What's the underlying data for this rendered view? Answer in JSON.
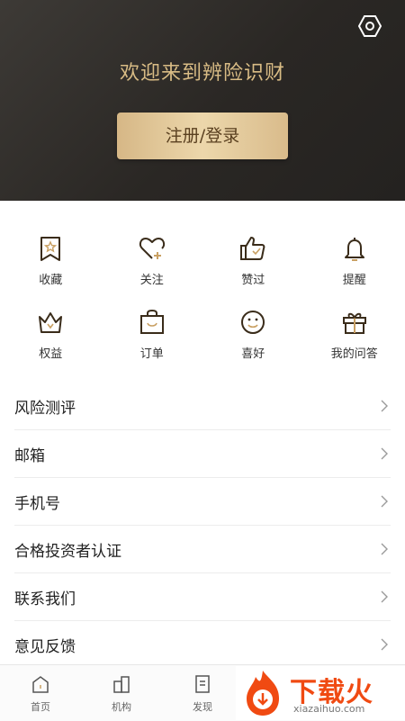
{
  "header": {
    "welcome": "欢迎来到辨险识财",
    "login_label": "注册/登录"
  },
  "quick_grid": [
    {
      "label": "收藏",
      "icon": "bookmark-icon"
    },
    {
      "label": "关注",
      "icon": "heart-plus-icon"
    },
    {
      "label": "赞过",
      "icon": "thumbs-up-icon"
    },
    {
      "label": "提醒",
      "icon": "bell-icon"
    },
    {
      "label": "权益",
      "icon": "crown-icon"
    },
    {
      "label": "订单",
      "icon": "bag-icon"
    },
    {
      "label": "喜好",
      "icon": "smile-icon"
    },
    {
      "label": "我的问答",
      "icon": "gift-icon"
    }
  ],
  "menu": [
    {
      "label": "风险测评"
    },
    {
      "label": "邮箱"
    },
    {
      "label": "手机号"
    },
    {
      "label": "合格投资者认证"
    },
    {
      "label": "联系我们"
    },
    {
      "label": "意见反馈"
    }
  ],
  "tabbar": [
    {
      "label": "首页",
      "icon": "home-icon"
    },
    {
      "label": "机构",
      "icon": "building-icon"
    },
    {
      "label": "发现",
      "icon": "discover-icon"
    }
  ],
  "watermark": {
    "text": "下载火",
    "url": "xiazaihuo.com"
  },
  "colors": {
    "accent_gold": "#d9bc85",
    "icon_brown": "#3a2c1a",
    "icon_gold_accent": "#c9a063",
    "watermark_orange": "#f04a12"
  }
}
